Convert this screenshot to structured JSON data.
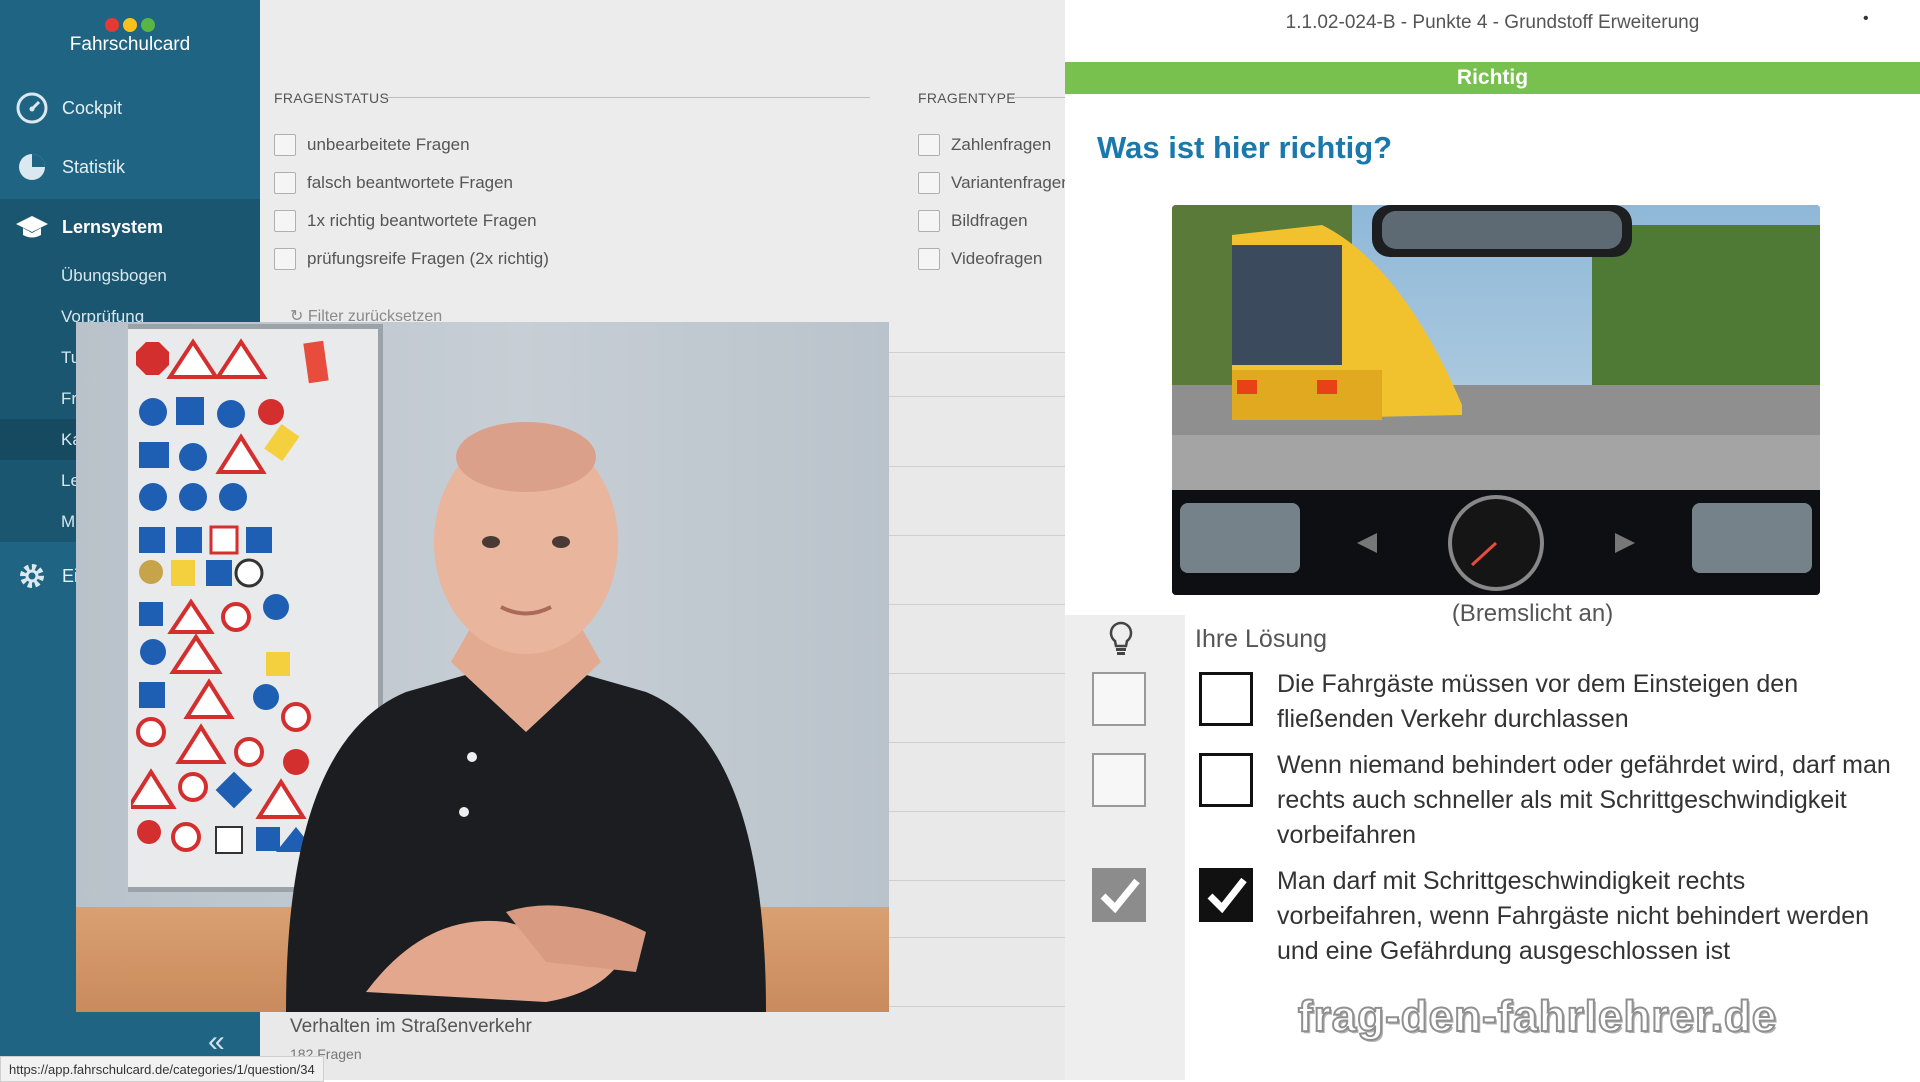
{
  "app": {
    "brand": "Fahrschulcard",
    "logo_colors": [
      "#e53935",
      "#f9c21b",
      "#5bb544"
    ]
  },
  "sidebar": {
    "items": [
      {
        "label": "Cockpit",
        "icon": "gauge-icon"
      },
      {
        "label": "Statistik",
        "icon": "pie-chart-icon"
      },
      {
        "label": "Lernsystem",
        "icon": "graduation-cap-icon"
      }
    ],
    "subitems": [
      "Übungsbogen",
      "Vorprüfung",
      "Tu",
      "Fr",
      "Ka",
      "Le",
      "M"
    ],
    "settings_label": "Ei",
    "collapse_icon": "double-chevron-left-icon"
  },
  "filters": {
    "status_heading": "FRAGENSTATUS",
    "status_options": [
      "unbearbeitete Fragen",
      "falsch beantwortete Fragen",
      "1x richtig beantwortete Fragen",
      "prüfungsreife Fragen (2x richtig)"
    ],
    "type_heading": "FRAGENTYPE",
    "type_options": [
      "Zahlenfragen",
      "Variantenfragen",
      "Bildfragen",
      "Videofragen"
    ],
    "reset_label": "Filter zurücksetzen"
  },
  "category": {
    "title": "Verhalten im Straßenverkehr",
    "count": "182 Fragen"
  },
  "status_url": "https://app.fahrschulcard.de/categories/1/question/34",
  "question": {
    "id_line": "1.1.02-024-B - Punkte 4 - Grundstoff Erweiterung",
    "result": "Richtig",
    "result_color": "#78c14f",
    "title": "Was ist hier richtig?",
    "image_caption": "(Bremslicht an)",
    "solution_label": "Ihre Lösung",
    "options": [
      {
        "text": "Die Fahrgäste müssen vor dem Einsteigen den fließenden Verkehr durchlassen",
        "solution": false,
        "answer": false
      },
      {
        "text": "Wenn niemand behindert oder gefährdet wird, darf man rechts auch schneller als mit Schrittgeschwindigkeit vorbeifahren",
        "solution": false,
        "answer": false
      },
      {
        "text": "Man darf mit Schrittgeschwindigkeit rechts vorbeifahren, wenn Fahrgäste nicht behindert werden und eine Gefährdung ausgeschlossen ist",
        "solution": true,
        "answer": true
      }
    ]
  },
  "watermark": "frag-den-fahrlehrer.de"
}
